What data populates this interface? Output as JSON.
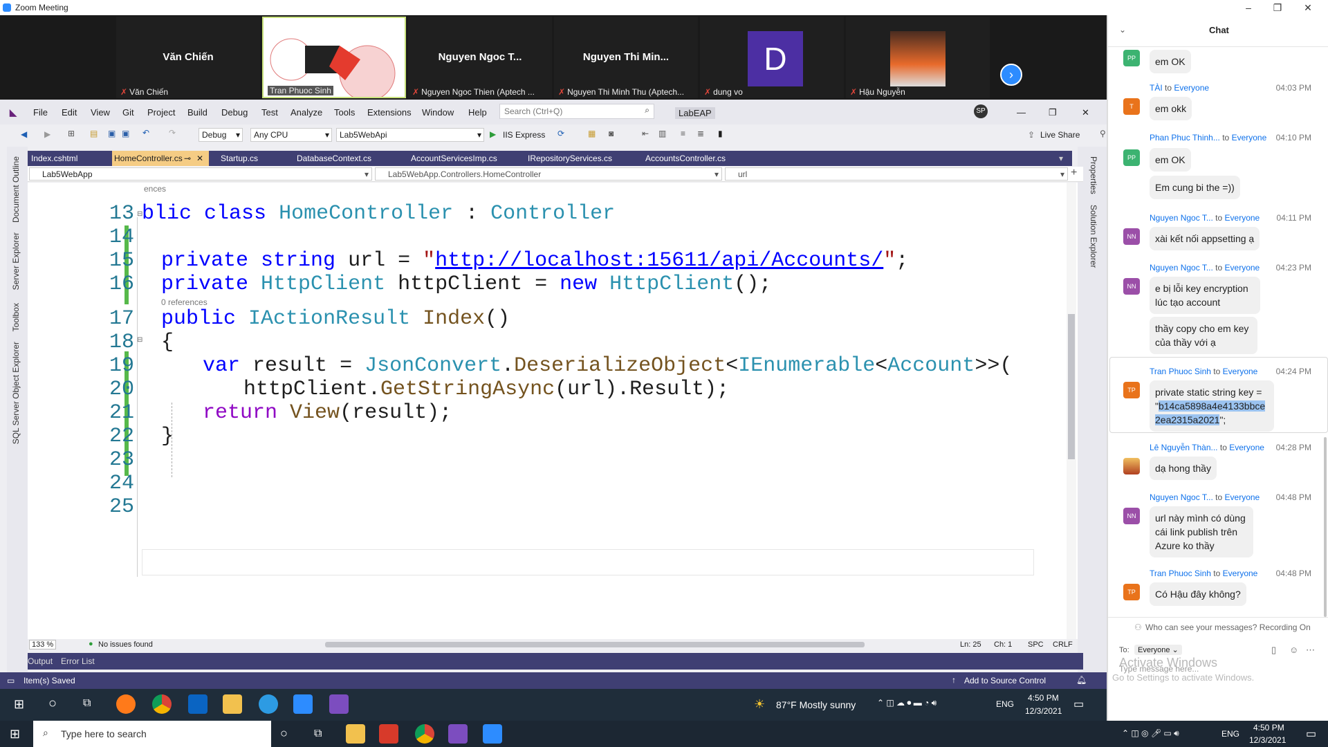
{
  "zoom": {
    "window_title": "Zoom Meeting",
    "participants": [
      {
        "big": "Văn Chiến",
        "name": "Văn Chiến"
      },
      {
        "big": "",
        "name": "Tran Phuoc Sinh"
      },
      {
        "big": "Nguyen Ngoc T...",
        "name": "Nguyen Ngoc Thien (Aptech ..."
      },
      {
        "big": "Nguyen Thi Min...",
        "name": "Nguyen Thi Minh Thu (Aptech..."
      },
      {
        "big": "D",
        "name": "dung vo"
      },
      {
        "big": "",
        "name": "Hậu Nguyễn"
      }
    ]
  },
  "vs": {
    "menu": [
      "File",
      "Edit",
      "View",
      "Git",
      "Project",
      "Build",
      "Debug",
      "Test",
      "Analyze",
      "Tools",
      "Extensions",
      "Window",
      "Help"
    ],
    "search_placeholder": "Search (Ctrl+Q)",
    "solution_name": "LabEAP",
    "user_initials": "SP",
    "toolbar": {
      "config": "Debug",
      "platform": "Any CPU",
      "project": "Lab5WebApi",
      "run": "IIS Express",
      "live_share": "Live Share"
    },
    "tabs": [
      "Index.cshtml",
      "HomeController.cs",
      "Startup.cs",
      "DatabaseContext.cs",
      "AccountServicesImp.cs",
      "IRepositoryServices.cs",
      "AccountsController.cs"
    ],
    "nav": {
      "project": "Lab5WebApp",
      "class": "Lab5WebApp.Controllers.HomeController",
      "member": "url"
    },
    "side_left": [
      "Document Outline",
      "Server Explorer",
      "Toolbox",
      "SQL Server Object Explorer"
    ],
    "side_right": [
      "Properties",
      "Solution Explorer"
    ],
    "code": {
      "ref_top": "ences",
      "ref_mid": "0 references",
      "lines": {
        "n13": "13",
        "n14": "14",
        "n15": "15",
        "n16": "16",
        "n17": "17",
        "n18": "18",
        "n19": "19",
        "n20": "20",
        "n21": "21",
        "n22": "22",
        "n23": "23",
        "n24": "24",
        "n25": "25"
      },
      "t": {
        "blic": "blic",
        "class": "class",
        "home": "HomeController",
        "colon": " : ",
        "controller": "Controller",
        "private": "private",
        "string": "string",
        "url_decl": "url",
        "eq": " = ",
        "url_value": "http://localhost:15611/api/Accounts/",
        "quote": "\"",
        "semi": ";",
        "httpclient_t": "HttpClient",
        "httpclient_v": "httpClient",
        "new": "new",
        "ctor": "();",
        "public": "public",
        "iaction": "IActionResult",
        "index": "Index",
        "parens": "()",
        "lbrace": "{",
        "rbrace": "}",
        "var": "var",
        "result": "result",
        "jsonconvert": "JsonConvert",
        "dot": ".",
        "deser": "DeserializeObject",
        "lt": "<",
        "ienum": "IEnumerable",
        "account": "Account",
        "gtgt": ">>(",
        "getstr": "GetStringAsync",
        "url_arg": "(url).Result);",
        "return": "return",
        "view": "View",
        "view_arg": "(result);"
      }
    },
    "editor_status": {
      "zoom": "133 %",
      "issues": "No issues found",
      "ln": "Ln: 25",
      "ch": "Ch: 1",
      "spc": "SPC",
      "crlf": "CRLF"
    },
    "out_tabs": [
      "Output",
      "Error List"
    ],
    "status": {
      "saved": "Item(s) Saved",
      "source_control": "Add to Source Control"
    }
  },
  "inner_taskbar": {
    "weather": "87°F  Mostly sunny",
    "lang": "ENG",
    "time": "4:50 PM",
    "date": "12/3/2021"
  },
  "outer_taskbar": {
    "search": "Type here to search",
    "lang": "ENG",
    "time": "4:50 PM",
    "date": "12/3/2021"
  },
  "chat": {
    "title": "Chat",
    "messages": [
      {
        "initials": "PP",
        "color": "#3cb371",
        "text": "em OK"
      },
      {
        "sender": "TÀI",
        "to": "to",
        "everyone": "Everyone",
        "time": "04:03 PM",
        "initials": "T",
        "color": "#e9731b",
        "text": "em okk"
      },
      {
        "sender": "Phan Phuc Thinh...",
        "to": "to",
        "everyone": "Everyone",
        "time": "04:10 PM",
        "initials": "PP",
        "color": "#3cb371",
        "text": "em OK",
        "text2": "Em cung bi the =))"
      },
      {
        "sender": "Nguyen Ngoc T...",
        "to": "to",
        "everyone": "Everyone",
        "time": "04:11 PM",
        "initials": "NN",
        "color": "#9b4fa8",
        "text": "xài kết nối appsetting ạ"
      },
      {
        "sender": "Nguyen Ngoc T...",
        "to": "to",
        "everyone": "Everyone",
        "time": "04:23 PM",
        "initials": "NN",
        "color": "#9b4fa8",
        "text": "e bị lỗi key encryption lúc tạo account",
        "text2": "thầy copy cho em key của thầy với ạ"
      },
      {
        "sender": "Tran Phuoc Sinh",
        "to": "to",
        "everyone": "Everyone",
        "time": "04:24 PM",
        "initials": "TP",
        "color": "#e9731b",
        "text_a": "private static string key = \"",
        "text_hl": "b14ca5898a4e4133bbce2ea2315a2021",
        "text_b": "\";"
      },
      {
        "sender": "Lê Nguyễn Thàn...",
        "to": "to",
        "everyone": "Everyone",
        "time": "04:28 PM",
        "text": "dạ hong thầy"
      },
      {
        "sender": "Nguyen Ngoc T...",
        "to": "to",
        "everyone": "Everyone",
        "time": "04:48 PM",
        "initials": "NN",
        "color": "#9b4fa8",
        "text": "url này mình có dùng cái link publish trên Azure ko thầy"
      },
      {
        "sender": "Tran Phuoc Sinh",
        "to": "to",
        "everyone": "Everyone",
        "time": "04:48 PM",
        "initials": "TP",
        "color": "#e9731b",
        "text": "Có Hậu đây không?"
      }
    ],
    "privacy_note": "Who can see your messages? Recording On",
    "to_label": "To:",
    "to_value": "Everyone",
    "input_placeholder": "Type message here...",
    "activate_title": "Activate Windows",
    "activate_sub": "Go to Settings to activate Windows."
  }
}
